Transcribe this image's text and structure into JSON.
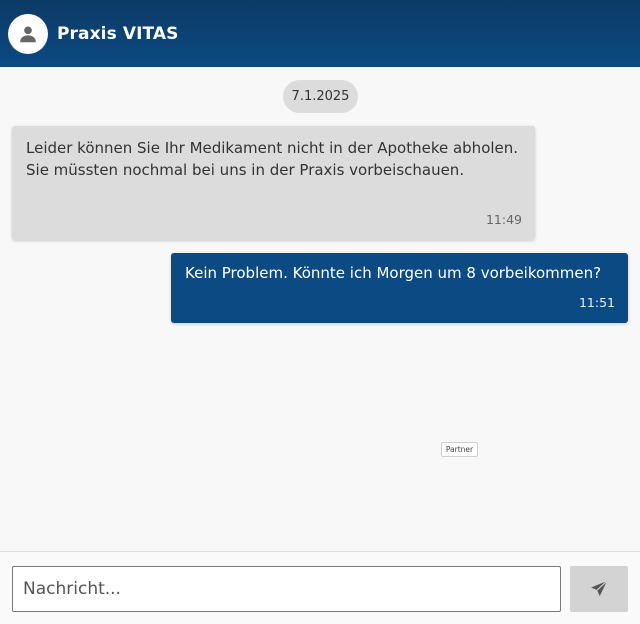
{
  "header": {
    "title": "Praxis VITAS",
    "avatar_icon": "person-icon"
  },
  "colors": {
    "header_bg": "#0b4a82",
    "incoming_bubble": "#dcdcdc",
    "outgoing_bubble": "#0b4a82",
    "send_button": "#d3d3d3"
  },
  "chat": {
    "date": "7.1.2025",
    "messages": [
      {
        "direction": "incoming",
        "text": "Leider können Sie Ihr Medikament nicht in der Apotheke abholen. Sie müssten nochmal bei uns in der Praxis vorbeischauen.",
        "time": "11:49"
      },
      {
        "direction": "outgoing",
        "text": "Kein Problem. Könnte ich Morgen um 8 vorbeikommen?",
        "time": "11:51"
      }
    ],
    "partner_tag": "Partner"
  },
  "composer": {
    "placeholder": "Nachricht...",
    "value": "",
    "send_icon": "send-icon"
  }
}
